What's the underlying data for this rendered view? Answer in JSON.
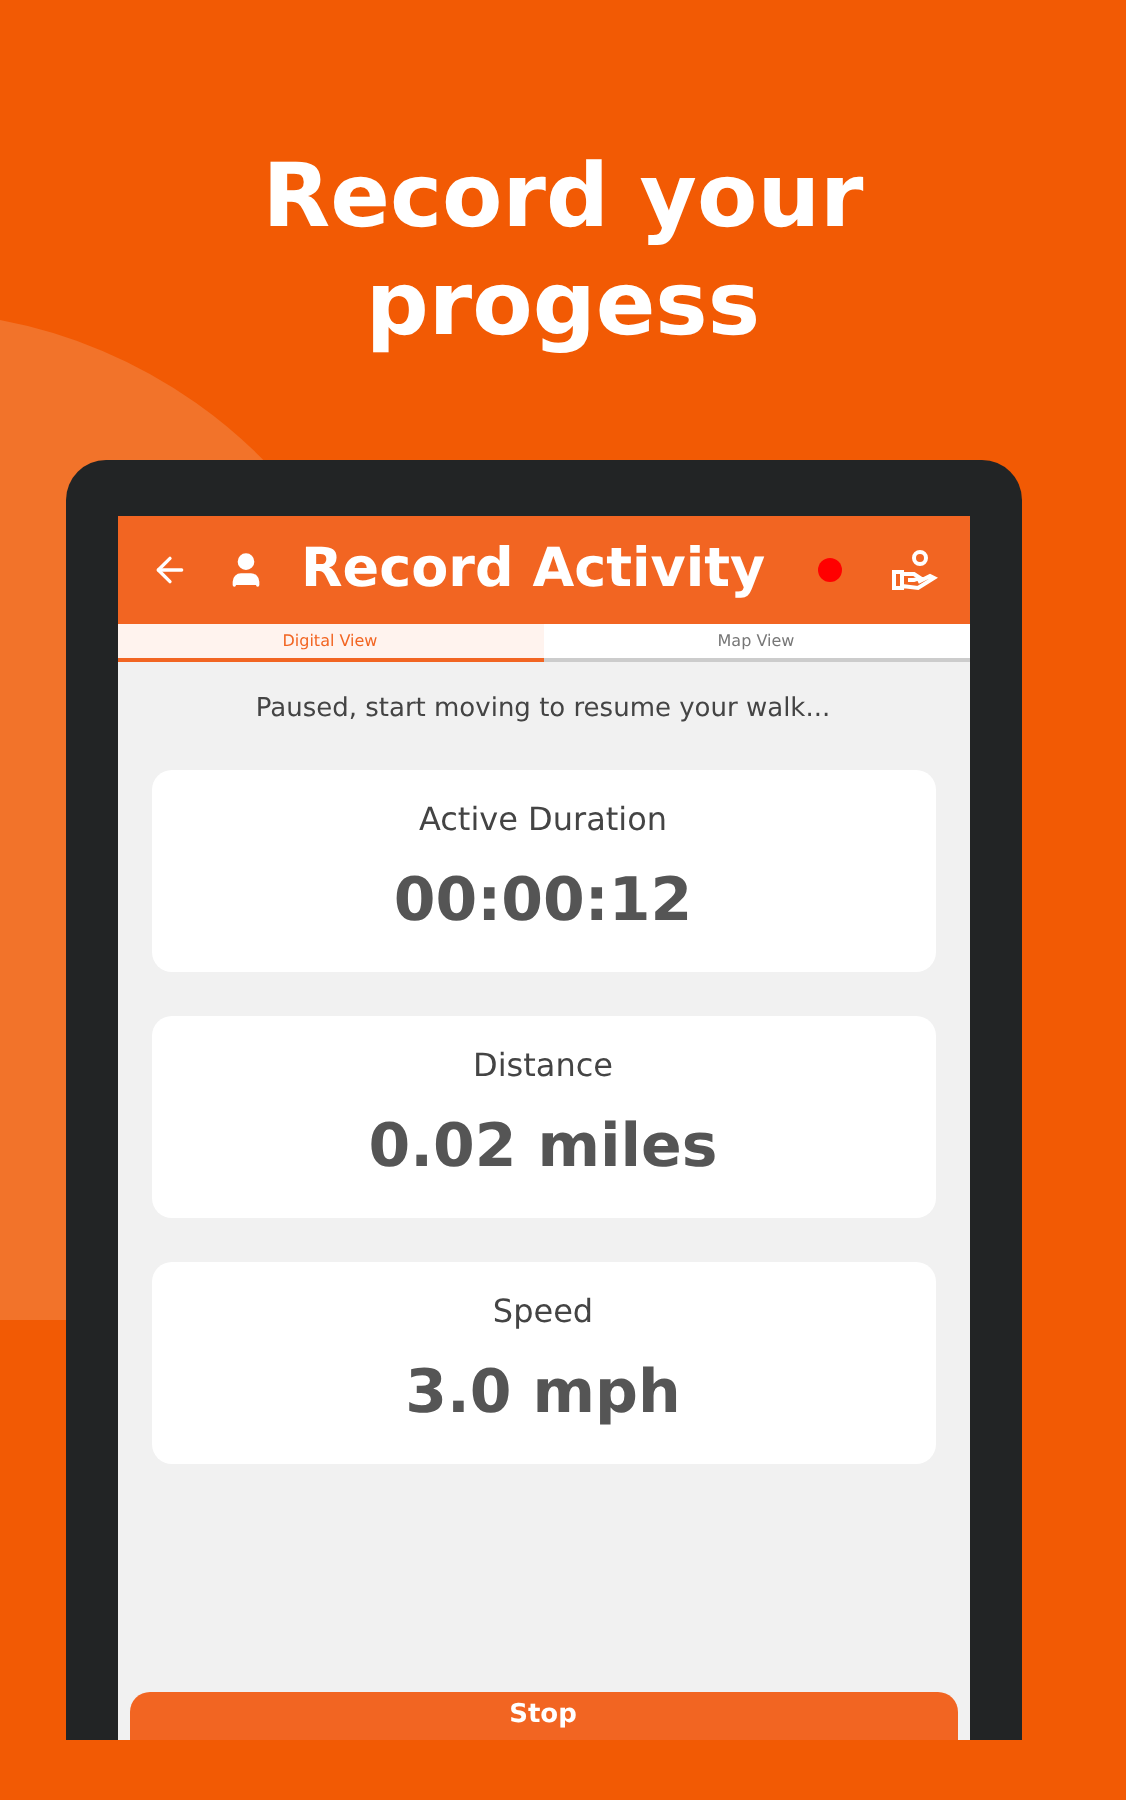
{
  "headline": "Record your progess",
  "app_bar": {
    "title": "Record Activity",
    "recording": true
  },
  "tabs": [
    {
      "label": "Digital View",
      "selected": true
    },
    {
      "label": "Map View",
      "selected": false
    }
  ],
  "status_message": "Paused, start moving to resume your walk...",
  "stats": [
    {
      "label": "Active Duration",
      "value": "00:00:12"
    },
    {
      "label": "Distance",
      "value": "0.02 miles"
    },
    {
      "label": "Speed",
      "value": "3.0 mph"
    }
  ],
  "stop_button": "Stop"
}
